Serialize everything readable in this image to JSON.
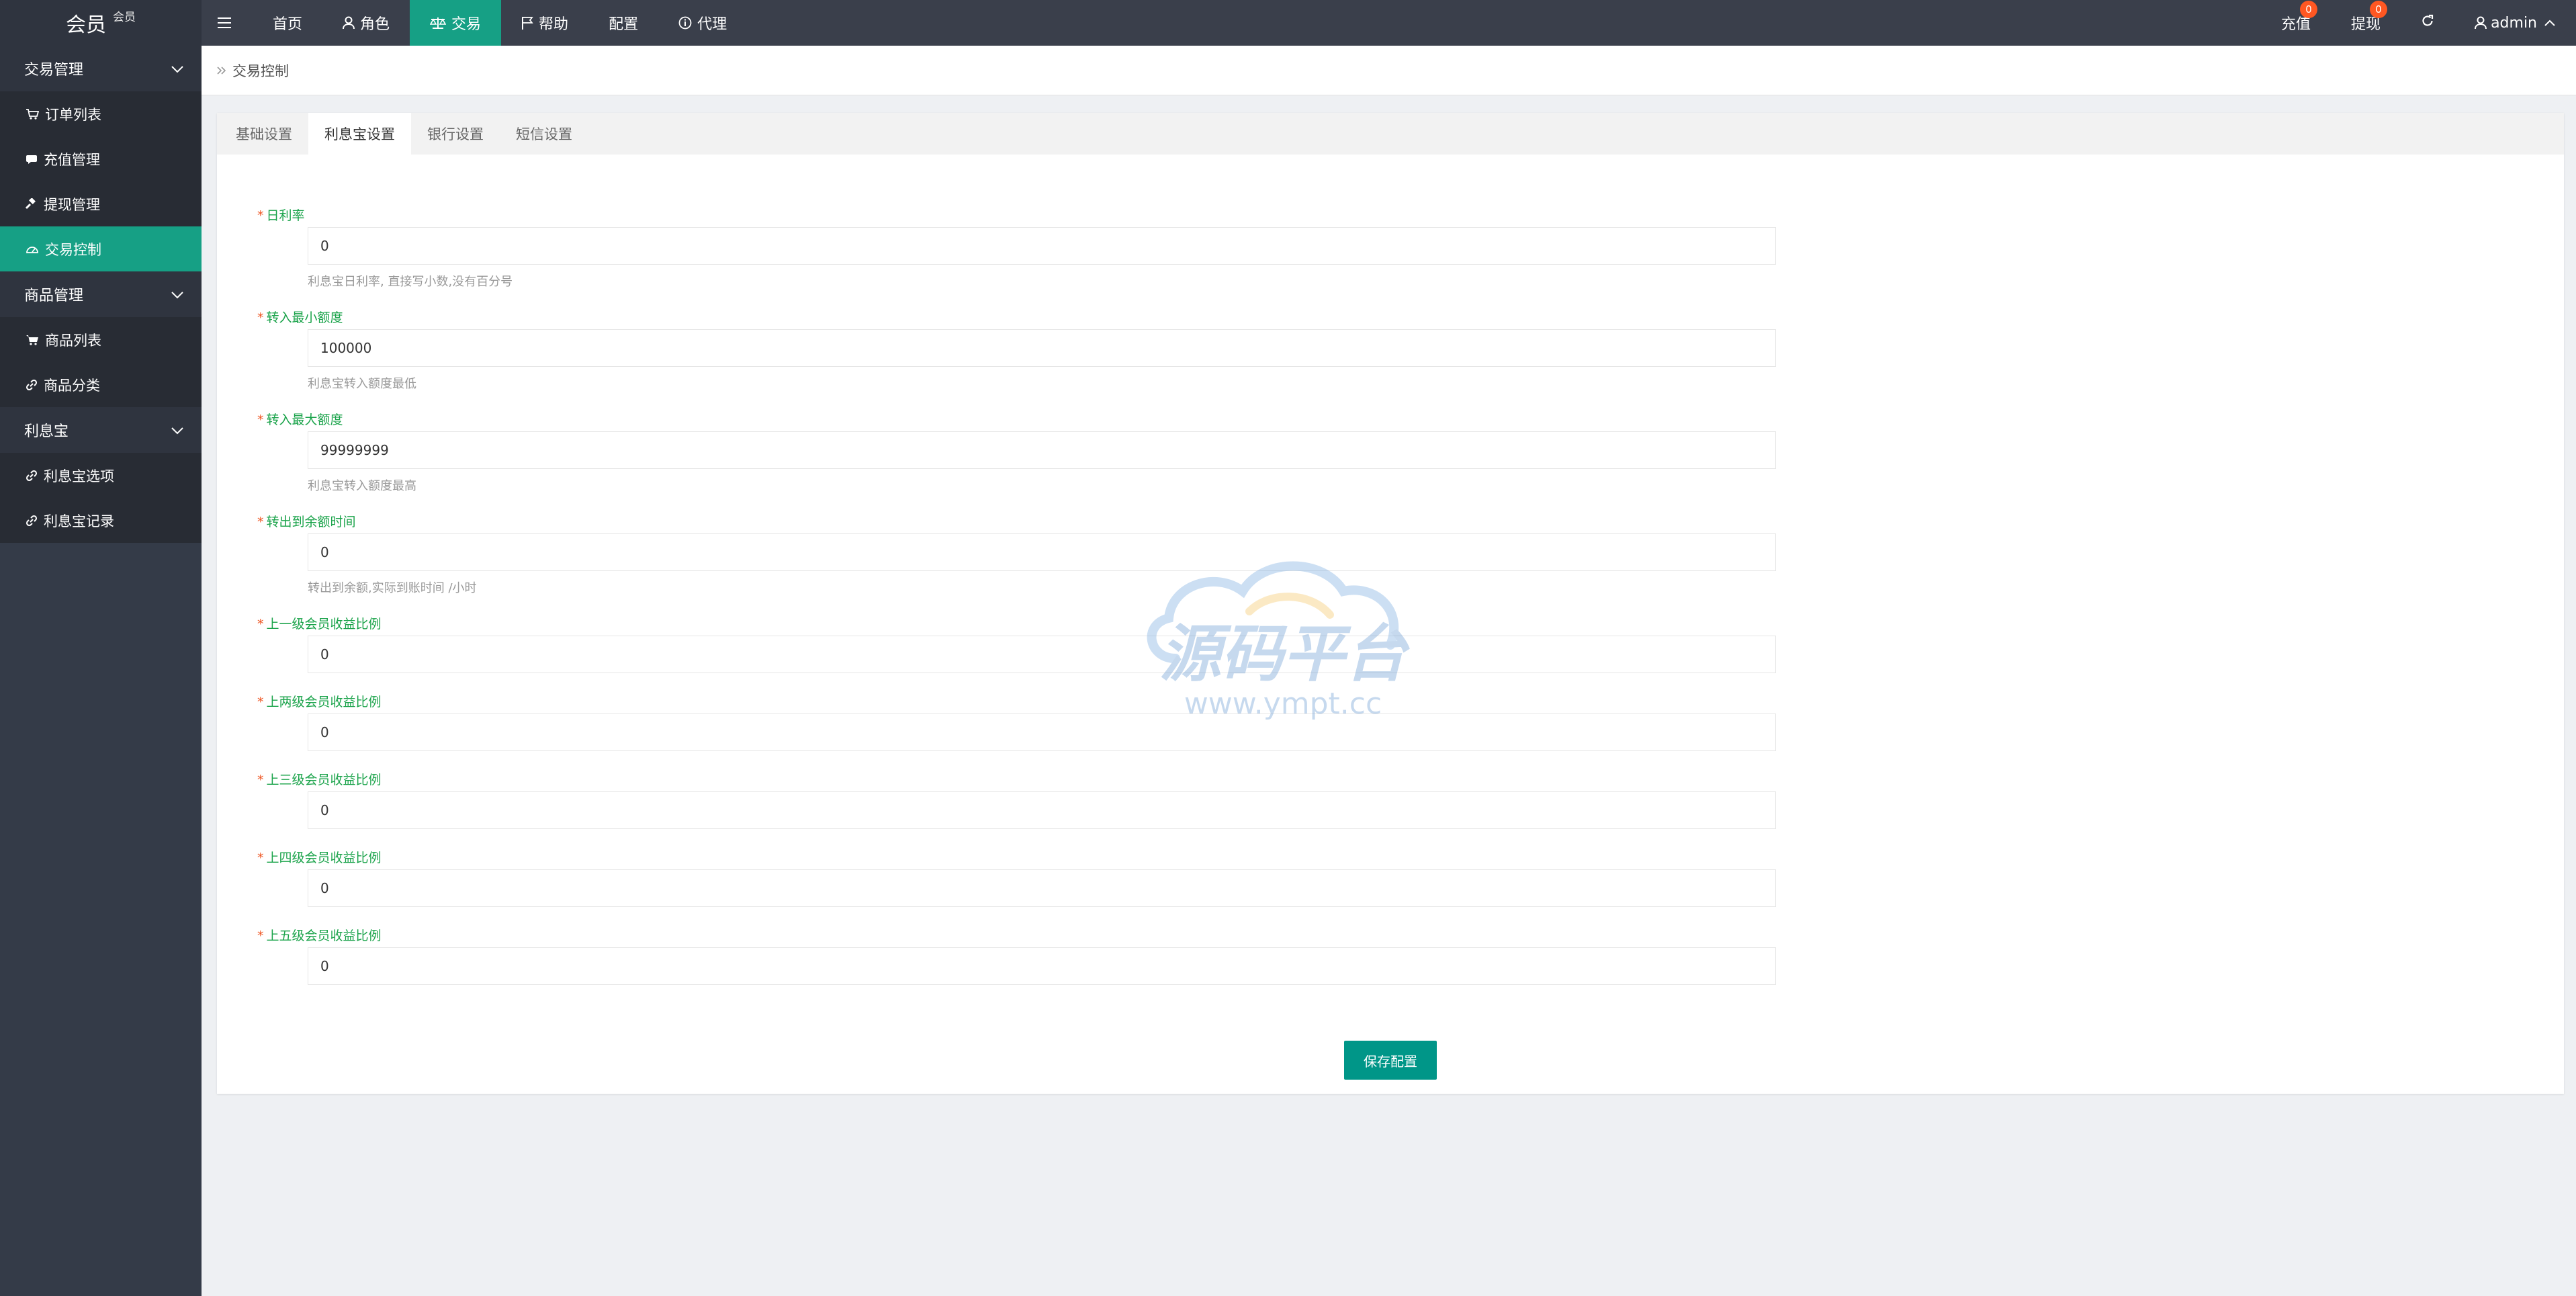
{
  "brand": {
    "title": "会员",
    "subtitle": "会员"
  },
  "topnav": [
    {
      "label": "",
      "icon": "menu-icon"
    },
    {
      "label": "首页",
      "icon": ""
    },
    {
      "label": "角色",
      "icon": "user-icon"
    },
    {
      "label": "交易",
      "icon": "balance-scale-icon",
      "active": true
    },
    {
      "label": "帮助",
      "icon": "flag-icon"
    },
    {
      "label": "配置",
      "icon": ""
    },
    {
      "label": "代理",
      "icon": "info-circle-icon"
    }
  ],
  "topright": {
    "recharge_label": "充值",
    "recharge_badge": "0",
    "withdraw_label": "提现",
    "withdraw_badge": "0",
    "refresh_icon": "refresh-icon",
    "user_label": "admin"
  },
  "sidebar": {
    "groups": [
      {
        "label": "交易管理",
        "items": [
          {
            "label": "订单列表",
            "icon": "cart-icon"
          },
          {
            "label": "充值管理",
            "icon": "comment-icon"
          },
          {
            "label": "提现管理",
            "icon": "gavel-icon"
          },
          {
            "label": "交易控制",
            "icon": "dashboard-icon",
            "active": true
          }
        ]
      },
      {
        "label": "商品管理",
        "items": [
          {
            "label": "商品列表",
            "icon": "shopping-cart-icon"
          },
          {
            "label": "商品分类",
            "icon": "link-icon"
          }
        ]
      },
      {
        "label": "利息宝",
        "items": [
          {
            "label": "利息宝选项",
            "icon": "link-icon"
          },
          {
            "label": "利息宝记录",
            "icon": "link-icon"
          }
        ]
      }
    ]
  },
  "breadcrumb": {
    "label": "交易控制"
  },
  "tabs": [
    {
      "label": "基础设置"
    },
    {
      "label": "利息宝设置",
      "active": true
    },
    {
      "label": "银行设置"
    },
    {
      "label": "短信设置"
    }
  ],
  "form": {
    "fields": [
      {
        "label": "日利率",
        "value": "0",
        "help": "利息宝日利率, 直接写小数,没有百分号"
      },
      {
        "label": "转入最小额度",
        "value": "100000",
        "help": "利息宝转入额度最低"
      },
      {
        "label": "转入最大额度",
        "value": "99999999",
        "help": "利息宝转入额度最高"
      },
      {
        "label": "转出到余额时间",
        "value": "0",
        "help": "转出到余额,实际到账时间 /小时"
      },
      {
        "label": "上一级会员收益比例",
        "value": "0",
        "help": ""
      },
      {
        "label": "上两级会员收益比例",
        "value": "0",
        "help": ""
      },
      {
        "label": "上三级会员收益比例",
        "value": "0",
        "help": ""
      },
      {
        "label": "上四级会员收益比例",
        "value": "0",
        "help": ""
      },
      {
        "label": "上五级会员收益比例",
        "value": "0",
        "help": ""
      }
    ],
    "save_label": "保存配置"
  },
  "watermark": {
    "title": "源码平台",
    "url": "www.ympt.cc"
  },
  "colors": {
    "accent": "#16a085",
    "topbar": "#3a3f4b",
    "sidebar": "#343b48",
    "label_green": "#1aa34a",
    "badge": "#ff5722"
  }
}
